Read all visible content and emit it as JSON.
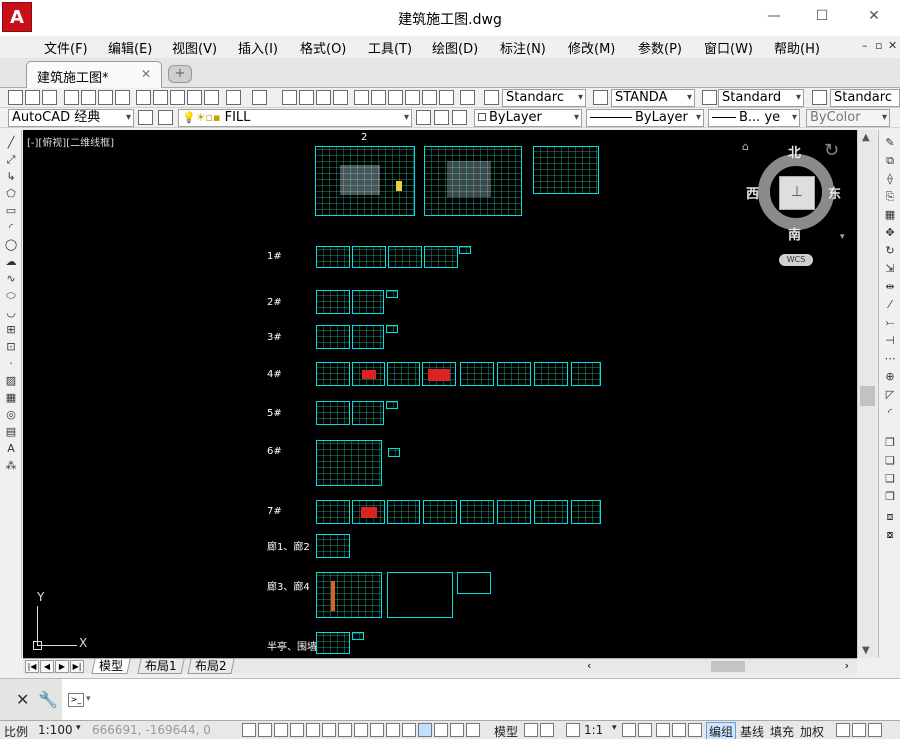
{
  "window": {
    "title": "建筑施工图.dwg",
    "logo": "A",
    "minimize": "—",
    "maximize": "☐",
    "close": "✕"
  },
  "menu": {
    "items": [
      "文件(F)",
      "编辑(E)",
      "视图(V)",
      "插入(I)",
      "格式(O)",
      "工具(T)",
      "绘图(D)",
      "标注(N)",
      "修改(M)",
      "参数(P)",
      "窗口(W)",
      "帮助(H)"
    ],
    "mdi_controls": [
      "–",
      "▫",
      "✕"
    ]
  },
  "tabs": {
    "document": "建筑施工图*",
    "close": "✕",
    "new": "+"
  },
  "toolbar1": {
    "text_style": "Standarc",
    "dim_style": "STANDA",
    "table_style": "Standard",
    "multileader_style": "Standarc"
  },
  "toolbar2": {
    "workspace": "AutoCAD 经典",
    "layer": "FILL",
    "color": "ByLayer",
    "linetype": "ByLayer",
    "lineweight": "B... ye",
    "plotstyle": "ByColor"
  },
  "viewport": {
    "label": "[-][俯视][二维线框]",
    "sheet_number": "2"
  },
  "drawing_labels": [
    "1#",
    "2#",
    "3#",
    "4#",
    "5#",
    "6#",
    "7#",
    "廊1、廊2",
    "廊3、廊4",
    "半亭、围墙"
  ],
  "viewcube": {
    "north": "北",
    "south": "南",
    "east": "东",
    "west": "西",
    "wcs": "WCS"
  },
  "ucs": {
    "x": "X",
    "y": "Y"
  },
  "layout_tabs": [
    "模型",
    "布局1",
    "布局2"
  ],
  "statusbar": {
    "scale_label": "比例",
    "scale_value": "1:100",
    "coords": "666691, -169644, 0",
    "model": "模型",
    "annotation_scale": "1:1",
    "group": "编组",
    "baseline": "基线",
    "fill": "填充",
    "weight": "加权"
  },
  "colors": {
    "canvas": "#000000",
    "sheet_border": "#00e0e0",
    "logo": "#c8101a"
  }
}
